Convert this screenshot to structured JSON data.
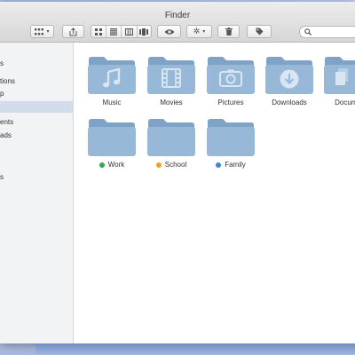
{
  "window": {
    "title": "Finder"
  },
  "toolbar": {
    "caret": "▾"
  },
  "sidebar": {
    "items": [
      {
        "label": "s",
        "selected": false
      },
      {
        "label": "tions",
        "selected": false
      },
      {
        "label": "p",
        "selected": false
      },
      {
        "label": "",
        "selected": true
      },
      {
        "label": "ents",
        "selected": false
      },
      {
        "label": "ads",
        "selected": false
      },
      {
        "label": "s",
        "selected": false
      }
    ]
  },
  "folders": [
    {
      "label": "Music",
      "icon": "music-note"
    },
    {
      "label": "Movies",
      "icon": "film-strip"
    },
    {
      "label": "Pictures",
      "icon": "camera"
    },
    {
      "label": "Downloads",
      "icon": "download-arrow"
    },
    {
      "label": "Docume",
      "icon": "documents"
    }
  ],
  "tagged_folders": [
    {
      "label": "Work",
      "tag_color": "#2fa84f"
    },
    {
      "label": "School",
      "tag_color": "#f0a020"
    },
    {
      "label": "Family",
      "tag_color": "#3c84d6"
    }
  ],
  "colors": {
    "folder": "#98b8d8",
    "folder_dark": "#7fa2c7",
    "emboss": "#d8e6f3"
  }
}
